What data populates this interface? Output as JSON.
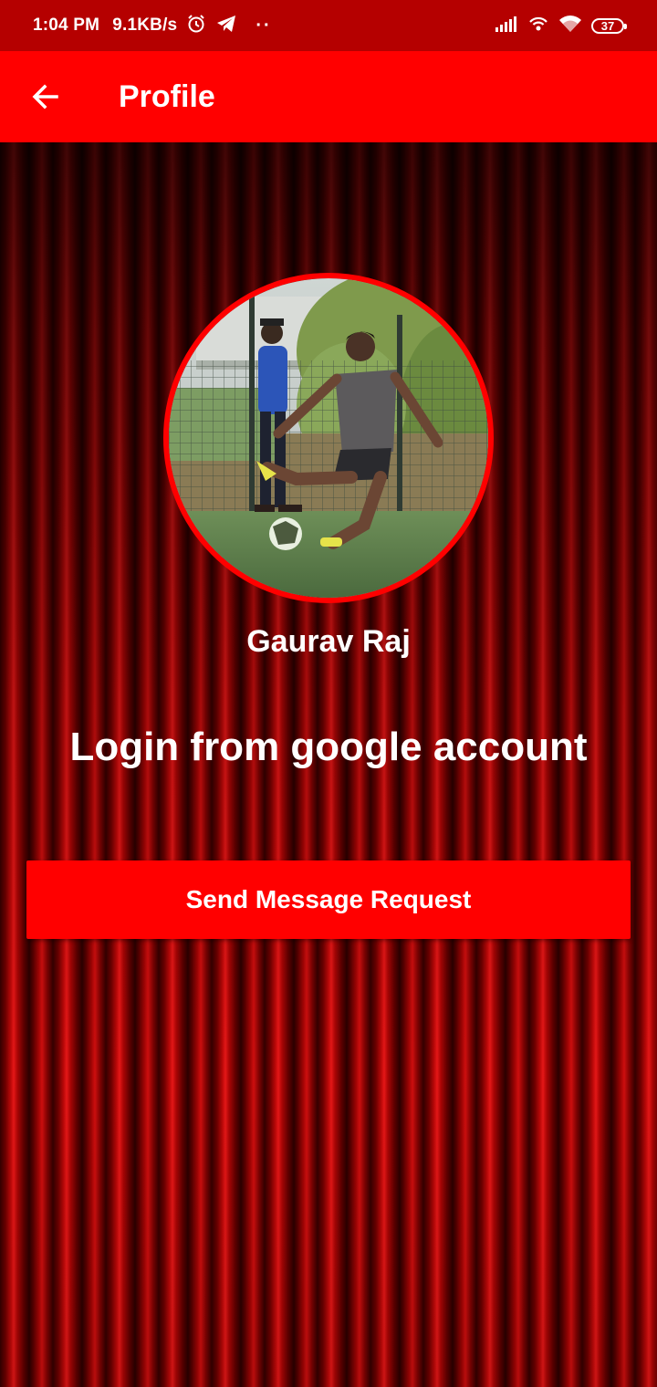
{
  "status_bar": {
    "time": "1:04 PM",
    "speed": "9.1KB/s",
    "dots": "··",
    "battery": "37",
    "icons": [
      "alarm-icon",
      "telegram-icon",
      "signal-icon",
      "hotspot-icon",
      "wifi-icon",
      "battery-icon"
    ]
  },
  "header": {
    "title": "Profile",
    "back_icon": "arrow-left-icon"
  },
  "profile": {
    "name": "Gaurav Raj",
    "login_text": "Login from google account",
    "button_label": "Send Message Request"
  },
  "colors": {
    "status_bar": "#b50000",
    "app_bar": "#ff0000",
    "button": "#ff0000",
    "avatar_border": "#ff0000",
    "text": "#ffffff"
  }
}
